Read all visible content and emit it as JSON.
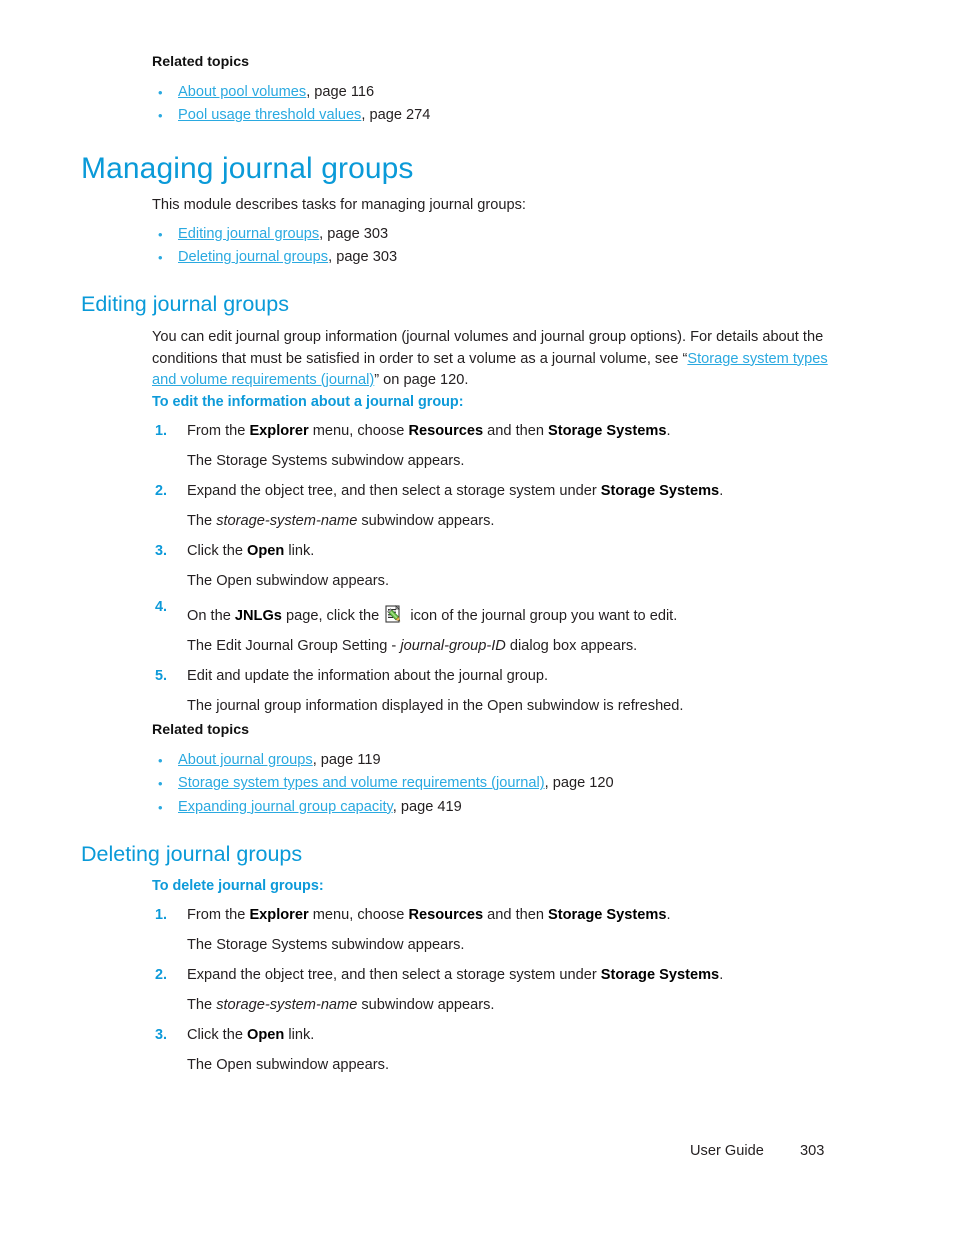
{
  "document": {
    "footer": {
      "label": "User Guide",
      "page_number": "303"
    }
  },
  "related_topics_top": {
    "heading": "Related topics",
    "items": [
      {
        "link": "About pool volumes",
        "suffix": ", page 116"
      },
      {
        "link": "Pool usage threshold values",
        "suffix": ", page 274"
      }
    ]
  },
  "managing": {
    "title": "Managing journal groups",
    "intro": "This module describes tasks for managing journal groups:",
    "items": [
      {
        "link": "Editing journal groups",
        "suffix": ", page 303"
      },
      {
        "link": "Deleting journal groups",
        "suffix": ", page 303"
      }
    ]
  },
  "editing": {
    "title": "Editing journal groups",
    "paragraph": {
      "part1": "You can edit journal group information (journal volumes and journal group options). For details about the conditions that must be satisfied in order to set a volume as a journal volume, see “",
      "link": "Storage system types and volume requirements (journal)",
      "part2": "” on page 120."
    },
    "procedure_heading": "To edit the information about a journal group:",
    "steps": [
      {
        "number": "1.",
        "text_parts": [
          {
            "t": "From the ",
            "style": "normal"
          },
          {
            "t": "Explorer",
            "style": "bold"
          },
          {
            "t": " menu, choose ",
            "style": "normal"
          },
          {
            "t": "Resources",
            "style": "bold"
          },
          {
            "t": " and then ",
            "style": "normal"
          },
          {
            "t": "Storage Systems",
            "style": "bold"
          },
          {
            "t": ".",
            "style": "normal"
          }
        ],
        "result": "The Storage Systems subwindow appears."
      },
      {
        "number": "2.",
        "text_parts": [
          {
            "t": "Expand the object tree, and then select a storage system under ",
            "style": "normal"
          },
          {
            "t": "Storage Systems",
            "style": "bold"
          },
          {
            "t": ".",
            "style": "normal"
          }
        ],
        "result_parts": [
          {
            "t": "The ",
            "style": "normal"
          },
          {
            "t": "storage-system-name",
            "style": "italic"
          },
          {
            "t": " subwindow appears.",
            "style": "normal"
          }
        ]
      },
      {
        "number": "3.",
        "text_parts": [
          {
            "t": "Click the ",
            "style": "normal"
          },
          {
            "t": "Open",
            "style": "bold"
          },
          {
            "t": " link.",
            "style": "normal"
          }
        ],
        "result": "The Open subwindow appears."
      },
      {
        "number": "4.",
        "icon": "edit-journal-group-icon",
        "text_parts": [
          {
            "t": "On the ",
            "style": "normal"
          },
          {
            "t": "JNLGs",
            "style": "bold"
          },
          {
            "t": " page, click the ",
            "style": "normal"
          },
          {
            "t": "[icon]",
            "style": "icon"
          },
          {
            "t": " icon of the journal group you want to edit.",
            "style": "normal"
          }
        ],
        "result_parts": [
          {
            "t": "The Edit Journal Group Setting - ",
            "style": "normal"
          },
          {
            "t": "journal-group-ID",
            "style": "italic"
          },
          {
            "t": " dialog box appears.",
            "style": "normal"
          }
        ]
      },
      {
        "number": "5.",
        "text_parts": [
          {
            "t": "Edit and update the information about the journal group.",
            "style": "normal"
          }
        ],
        "result": "The journal group information displayed in the Open subwindow is refreshed."
      }
    ]
  },
  "related_topics_mid": {
    "heading": "Related topics",
    "items": [
      {
        "link": "About journal groups",
        "suffix": ", page 119"
      },
      {
        "link": "Storage system types and volume requirements (journal)",
        "suffix": ", page 120"
      },
      {
        "link": "Expanding journal group capacity",
        "suffix": ", page 419"
      }
    ]
  },
  "deleting": {
    "title": "Deleting journal groups",
    "procedure_heading": "To delete journal groups:",
    "steps": [
      {
        "number": "1.",
        "text_parts": [
          {
            "t": "From the ",
            "style": "normal"
          },
          {
            "t": "Explorer",
            "style": "bold"
          },
          {
            "t": " menu, choose ",
            "style": "normal"
          },
          {
            "t": "Resources",
            "style": "bold"
          },
          {
            "t": " and then ",
            "style": "normal"
          },
          {
            "t": "Storage Systems",
            "style": "bold"
          },
          {
            "t": ".",
            "style": "normal"
          }
        ],
        "result": "The Storage Systems subwindow appears."
      },
      {
        "number": "2.",
        "text_parts": [
          {
            "t": "Expand the object tree, and then select a storage system under ",
            "style": "normal"
          },
          {
            "t": "Storage Systems",
            "style": "bold"
          },
          {
            "t": ".",
            "style": "normal"
          }
        ],
        "result_parts": [
          {
            "t": "The ",
            "style": "normal"
          },
          {
            "t": "storage-system-name",
            "style": "italic"
          },
          {
            "t": " subwindow appears.",
            "style": "normal"
          }
        ]
      },
      {
        "number": "3.",
        "text_parts": [
          {
            "t": "Click the ",
            "style": "normal"
          },
          {
            "t": "Open",
            "style": "bold"
          },
          {
            "t": " link.",
            "style": "normal"
          }
        ],
        "result": "The Open subwindow appears."
      }
    ]
  },
  "colors": {
    "heading_blue": "#0a9ad8",
    "link_blue": "#2aa9e0",
    "body_black": "#231f20",
    "icon_green": "#5cb830"
  },
  "bullet_glyph": "•"
}
